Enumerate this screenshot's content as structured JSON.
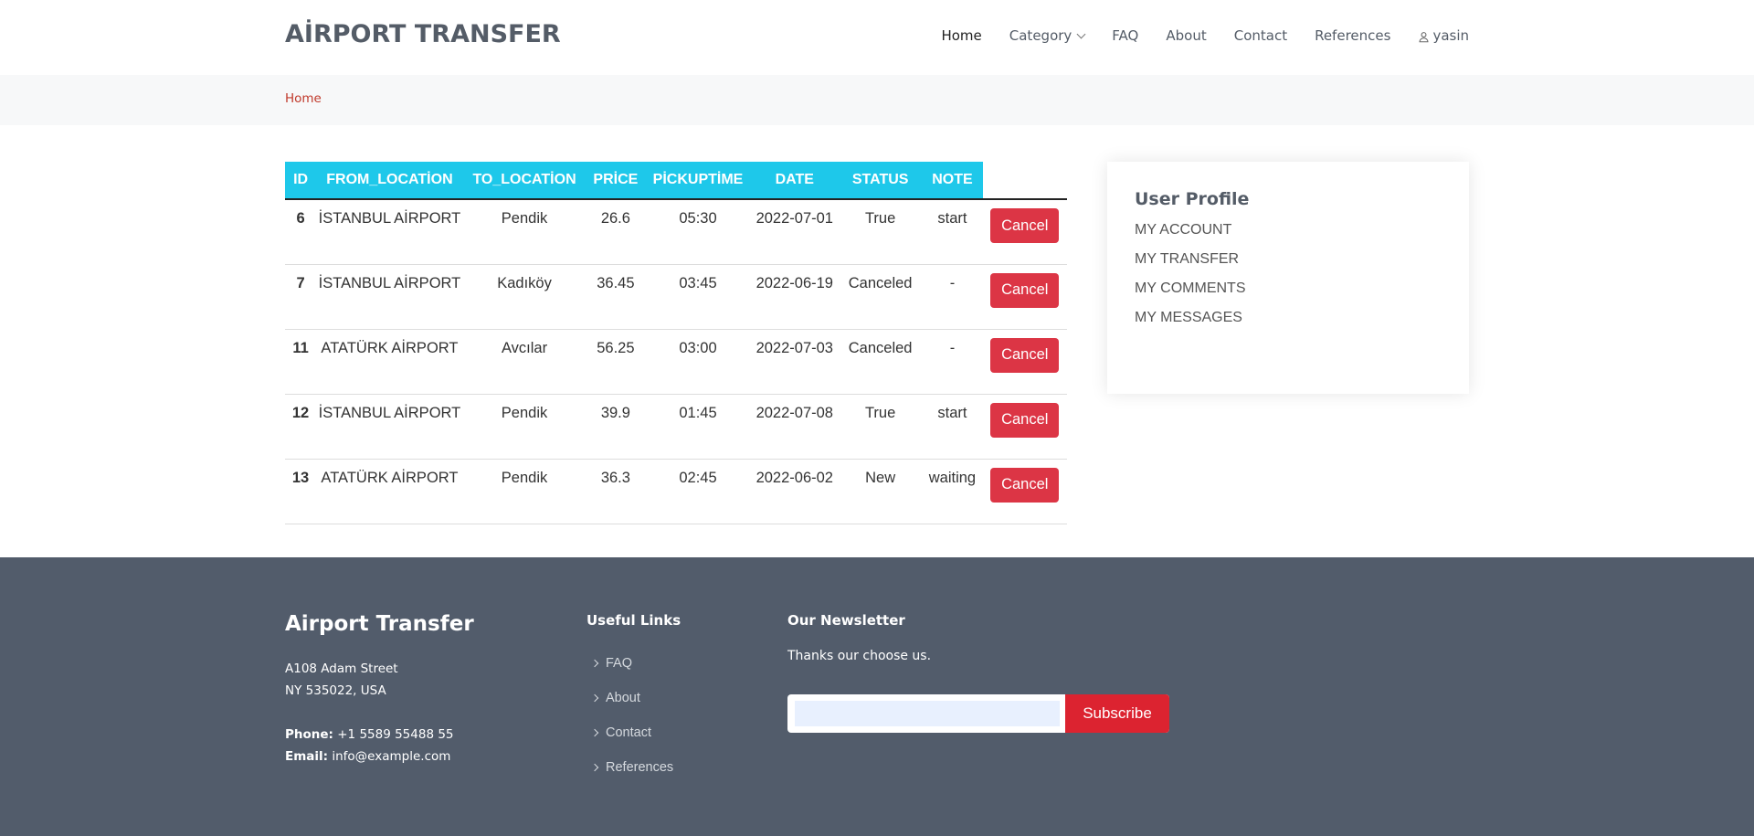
{
  "header": {
    "logo": "AİRPORT TRANSFER",
    "nav": {
      "home": "Home",
      "category": "Category",
      "faq": "FAQ",
      "about": "About",
      "contact": "Contact",
      "references": "References",
      "user": "yasin"
    }
  },
  "breadcrumb": {
    "home": "Home"
  },
  "table": {
    "headers": [
      "ID",
      "FROM_LOCATİON",
      "TO_LOCATİON",
      "PRİCE",
      "PİCKUPTİME",
      "DATE",
      "STATUS",
      "NOTE"
    ],
    "rows": [
      {
        "id": "6",
        "from": "İSTANBUL AİRPORT",
        "to": "Pendik",
        "price": "26.6",
        "pickup": "05:30",
        "date": "2022-07-01",
        "status": "True",
        "note": "start",
        "action": "Cancel"
      },
      {
        "id": "7",
        "from": "İSTANBUL AİRPORT",
        "to": "Kadıköy",
        "price": "36.45",
        "pickup": "03:45",
        "date": "2022-06-19",
        "status": "Canceled",
        "note": "-",
        "action": "Cancel"
      },
      {
        "id": "11",
        "from": "ATATÜRK AİRPORT",
        "to": "Avcılar",
        "price": "56.25",
        "pickup": "03:00",
        "date": "2022-07-03",
        "status": "Canceled",
        "note": "-",
        "action": "Cancel"
      },
      {
        "id": "12",
        "from": "İSTANBUL AİRPORT",
        "to": "Pendik",
        "price": "39.9",
        "pickup": "01:45",
        "date": "2022-07-08",
        "status": "True",
        "note": "start",
        "action": "Cancel"
      },
      {
        "id": "13",
        "from": "ATATÜRK AİRPORT",
        "to": "Pendik",
        "price": "36.3",
        "pickup": "02:45",
        "date": "2022-06-02",
        "status": "New",
        "note": "waiting",
        "action": "Cancel"
      }
    ]
  },
  "profile": {
    "title": "User Profile",
    "links": [
      "MY ACCOUNT",
      "MY TRANSFER",
      "MY COMMENTS",
      "MY MESSAGES"
    ]
  },
  "footer": {
    "brand": "Airport Transfer",
    "address_line1": "A108 Adam Street",
    "address_line2": "NY 535022, USA",
    "phone_label": "Phone:",
    "phone": "+1 5589 55488 55",
    "email_label": "Email:",
    "email": "info@example.com",
    "links_title": "Useful Links",
    "links": [
      "FAQ",
      "About",
      "Contact",
      "References"
    ],
    "newsletter_title": "Our Newsletter",
    "newsletter_text": "Thanks our choose us.",
    "subscribe_label": "Subscribe"
  },
  "colors": {
    "table_header": "#1ec8ea",
    "cancel_button": "#dc3545",
    "footer_bg": "#525c6b",
    "breadcrumb": "#c0392b"
  }
}
